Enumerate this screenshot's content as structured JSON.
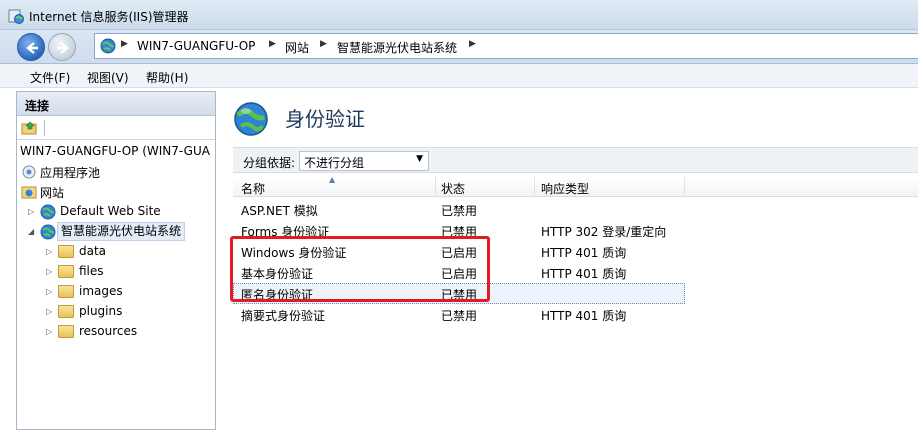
{
  "window": {
    "title": "Internet 信息服务(IIS)管理器"
  },
  "address": {
    "breadcrumbs": [
      "WIN7-GUANGFU-OP",
      "网站",
      "智慧能源光伏电站系统"
    ]
  },
  "menu": {
    "items": [
      "文件(F)",
      "视图(V)",
      "帮助(H)"
    ]
  },
  "connections": {
    "header": "连接",
    "server": "WIN7-GUANGFU-OP (WIN7-GUA",
    "app_pools": "应用程序池",
    "sites": "网站",
    "default_site": "Default Web Site",
    "current_site": "智慧能源光伏电站系统",
    "folders": [
      "data",
      "files",
      "images",
      "plugins",
      "resources"
    ]
  },
  "main": {
    "title": "身份验证",
    "group_by_label": "分组依据:",
    "group_by_value": "不进行分组",
    "columns": [
      "名称",
      "状态",
      "响应类型"
    ],
    "rows": [
      {
        "name": "ASP.NET 模拟",
        "status": "已禁用",
        "response": ""
      },
      {
        "name": "Forms 身份验证",
        "status": "已禁用",
        "response": "HTTP 302 登录/重定向"
      },
      {
        "name": "Windows 身份验证",
        "status": "已启用",
        "response": "HTTP 401 质询"
      },
      {
        "name": "基本身份验证",
        "status": "已启用",
        "response": "HTTP 401 质询"
      },
      {
        "name": "匿名身份验证",
        "status": "已禁用",
        "response": ""
      },
      {
        "name": "摘要式身份验证",
        "status": "已禁用",
        "response": "HTTP 401 质询"
      }
    ]
  },
  "colors": {
    "highlight_border": "#e51a22",
    "title_text": "#1e395b"
  }
}
